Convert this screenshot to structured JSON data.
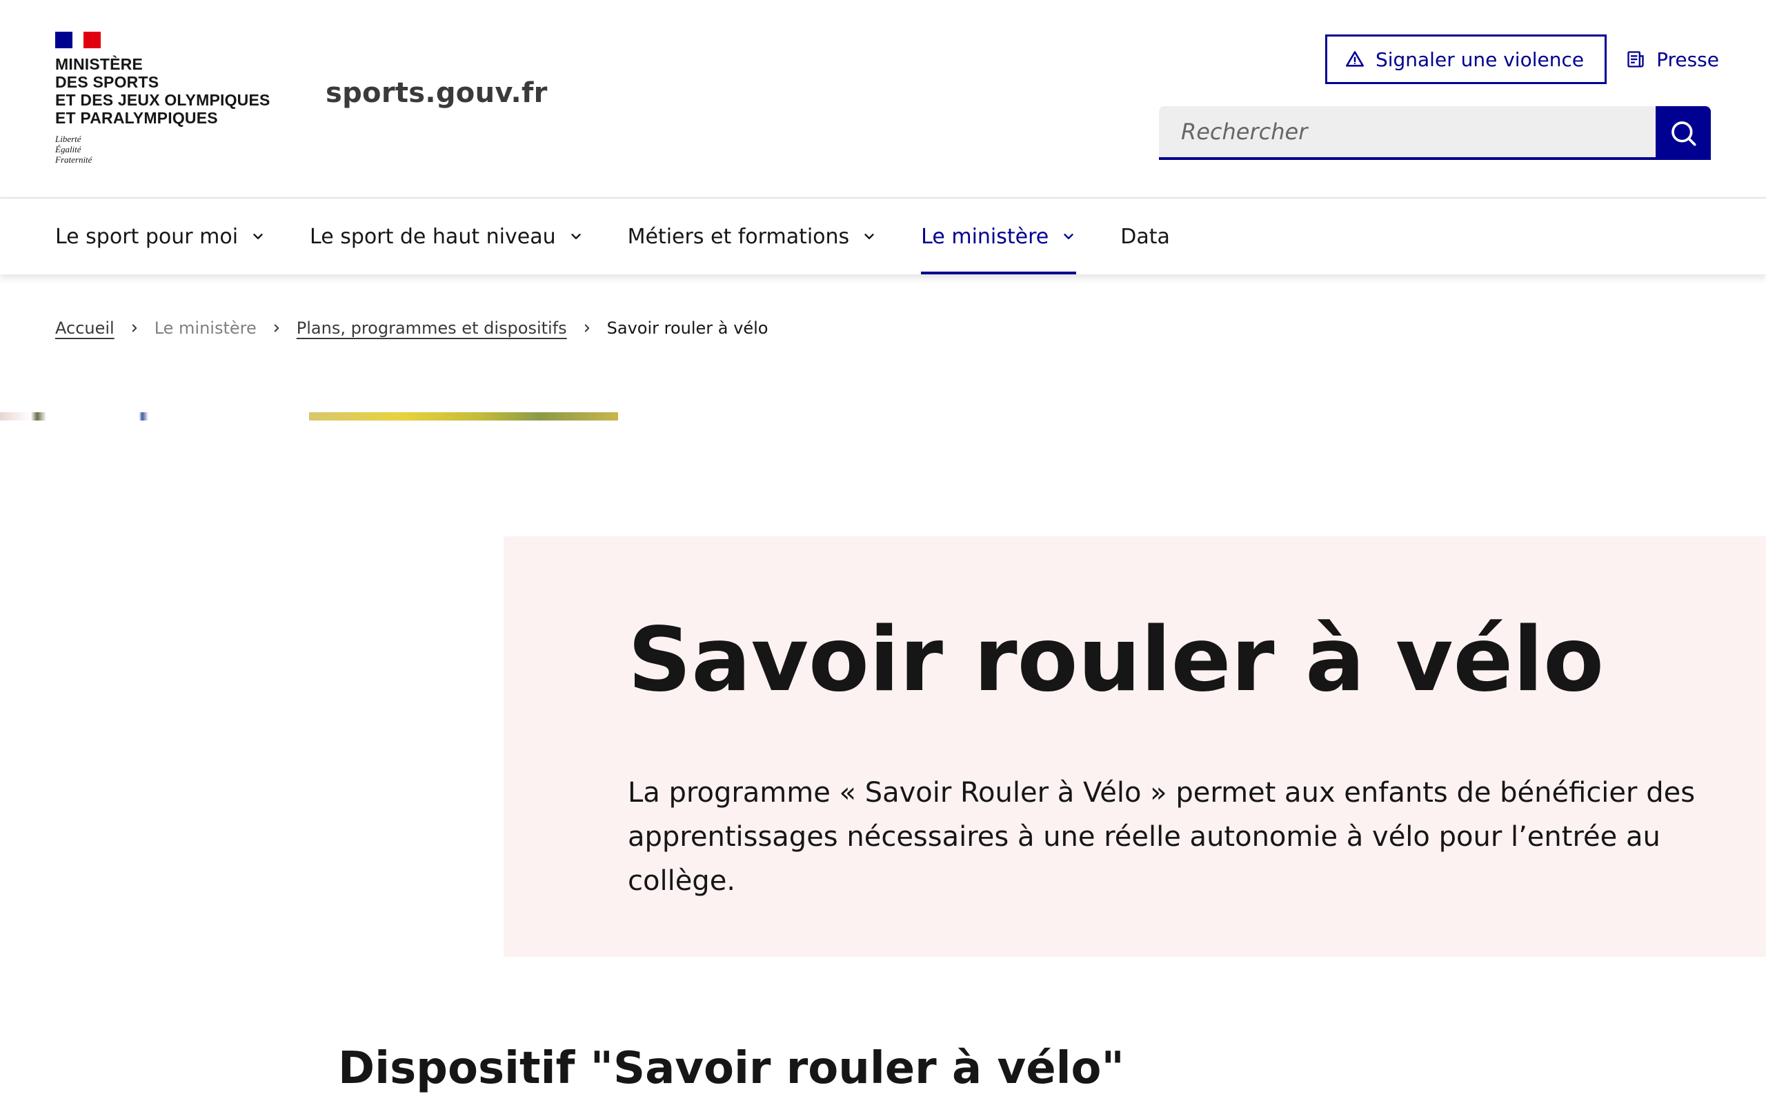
{
  "header": {
    "ministry_lines": [
      "Ministère",
      "des Sports",
      "et des Jeux Olympiques",
      "et Paralympiques"
    ],
    "devise_lines": [
      "Liberté",
      "Égalité",
      "Fraternité"
    ],
    "service_title": "sports.gouv.fr",
    "tools": {
      "violence_label": "Signaler une violence",
      "presse_label": "Presse"
    },
    "search": {
      "placeholder": "Rechercher",
      "value": ""
    }
  },
  "nav": {
    "items": [
      {
        "label": "Le sport pour moi",
        "has_menu": true,
        "active": false
      },
      {
        "label": "Le sport de haut niveau",
        "has_menu": true,
        "active": false
      },
      {
        "label": "Métiers et formations",
        "has_menu": true,
        "active": false
      },
      {
        "label": "Le ministère",
        "has_menu": true,
        "active": true
      },
      {
        "label": "Data",
        "has_menu": false,
        "active": false
      }
    ]
  },
  "breadcrumb": {
    "items": [
      {
        "label": "Accueil",
        "link": true
      },
      {
        "label": "Le ministère",
        "link": false
      },
      {
        "label": "Plans, programmes et dispositifs",
        "link": true
      },
      {
        "label": "Savoir rouler à vélo",
        "link": false,
        "current": true
      }
    ]
  },
  "hero": {
    "title": "Savoir rouler à vélo",
    "description": "La programme « Savoir Rouler à Vélo » permet aux enfants de bénéficier des apprentissages nécessaires à une réelle autonomie à vélo pour l’entrée au collège."
  },
  "section": {
    "title": "Dispositif \"Savoir rouler à vélo\""
  },
  "colors": {
    "primary": "#000091",
    "hero_background": "#fcf2f1",
    "text": "#161616"
  },
  "icons": {
    "violence": "warning-icon",
    "presse": "newspaper-icon",
    "search": "search-icon",
    "nav_chevron": "chevron-down-icon",
    "breadcrumb_sep": "chevron-right-icon"
  }
}
